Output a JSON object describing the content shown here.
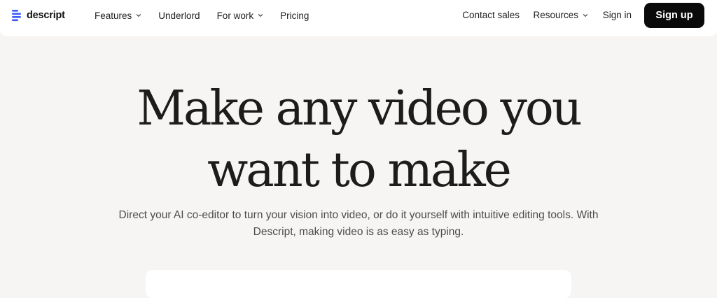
{
  "brand": {
    "name": "descript"
  },
  "nav": {
    "left": [
      {
        "label": "Features",
        "has_dropdown": true
      },
      {
        "label": "Underlord",
        "has_dropdown": false
      },
      {
        "label": "For work",
        "has_dropdown": true
      },
      {
        "label": "Pricing",
        "has_dropdown": false
      }
    ],
    "right": [
      {
        "label": "Contact sales",
        "has_dropdown": false
      },
      {
        "label": "Resources",
        "has_dropdown": true
      },
      {
        "label": "Sign in",
        "has_dropdown": false
      }
    ],
    "signup_label": "Sign up"
  },
  "hero": {
    "title_line1": "Make any video you",
    "title_line2": "want to make",
    "subtitle_line1": "Direct your AI co-editor to turn your vision into video, or do it yourself with intuitive editing tools. With",
    "subtitle_line2": "Descript, making video is as easy as typing."
  },
  "colors": {
    "background": "#f6f5f3",
    "nav_background": "#ffffff",
    "signup_button": "#0a0a0a",
    "logo_accent": "#3b5bfd"
  }
}
